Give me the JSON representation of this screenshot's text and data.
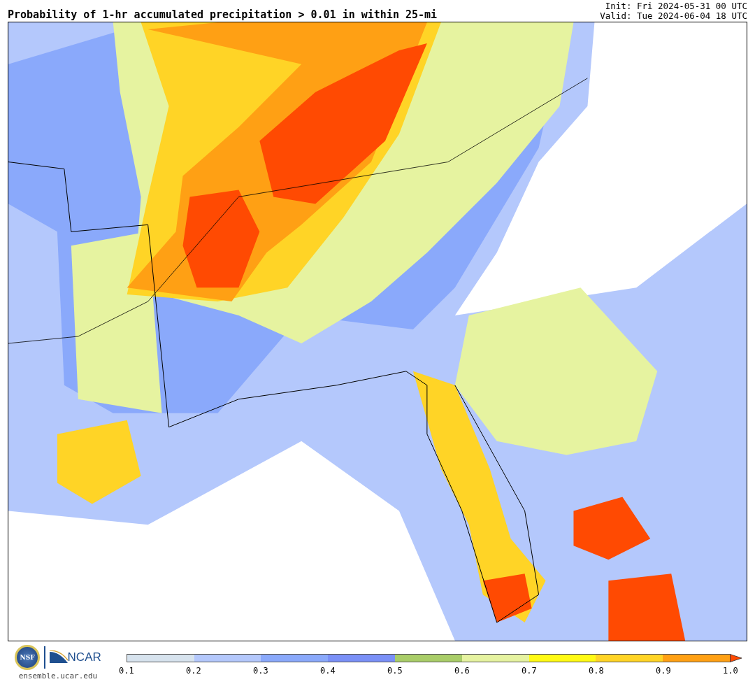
{
  "title": "Probability of 1-hr accumulated precipitation > 0.01 in within 25-mi",
  "init": "Init: Fri 2024-05-31 00 UTC",
  "valid": "Valid: Tue 2024-06-04 18 UTC",
  "logos": {
    "seal": "NSF",
    "wordmark": "NCAR",
    "site": "ensemble.ucar.edu"
  },
  "colorbar": {
    "segments": [
      {
        "color": "#d7e3ee"
      },
      {
        "color": "#b4c8fc"
      },
      {
        "color": "#8aa9fb"
      },
      {
        "color": "#7a90f7"
      },
      {
        "color": "#a9cd68"
      },
      {
        "color": "#e6f3a0"
      },
      {
        "color": "#fffa14"
      },
      {
        "color": "#ffd426"
      },
      {
        "color": "#ffa014"
      },
      {
        "color": "#ff4a02",
        "kind": "arrow"
      }
    ],
    "ticks": [
      "0.1",
      "0.2",
      "0.3",
      "0.4",
      "0.5",
      "0.6",
      "0.7",
      "0.8",
      "0.9",
      "1.0"
    ]
  }
}
